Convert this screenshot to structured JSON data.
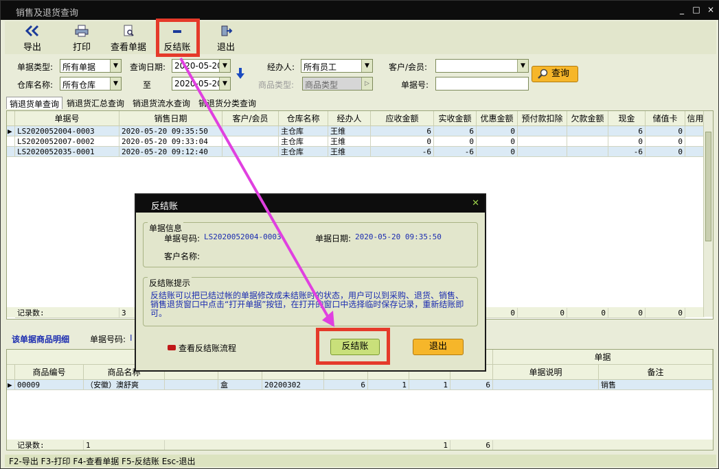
{
  "window": {
    "title": "销售及退货查询",
    "controls": [
      "_",
      "□",
      "×"
    ]
  },
  "toolbar": {
    "export": "导出",
    "print": "打印",
    "view": "查看单据",
    "reverse": "反结账",
    "exit": "退出"
  },
  "filters": {
    "doc_type_label": "单据类型:",
    "doc_type_value": "所有单据",
    "query_date_label": "查询日期:",
    "date_from": "2020-05-20",
    "staff_label": "经办人:",
    "staff_value": "所有员工",
    "customer_label": "客户/会员:",
    "customer_value": "",
    "warehouse_label": "仓库名称:",
    "warehouse_value": "所有仓库",
    "to_label": "至",
    "date_to": "2020-05-20",
    "goods_type_label": "商品类型:",
    "goods_type_value": "商品类型",
    "doc_no_label": "单据号:",
    "doc_no_value": "",
    "query_button": "查询"
  },
  "tabs": [
    "销退货单查询",
    "销退货汇总查询",
    "销退货流水查询",
    "销退货分类查询"
  ],
  "main_grid": {
    "headers": [
      "单据号",
      "销售日期",
      "客户/会员",
      "仓库名称",
      "经办人",
      "应收金额",
      "实收金额",
      "优惠金额",
      "预付款扣除",
      "欠款金额",
      "现金",
      "储值卡",
      "信用"
    ],
    "rows": [
      [
        "LS2020052004-0003",
        "2020-05-20 09:35:50",
        "",
        "主仓库",
        "王维",
        "6",
        "6",
        "0",
        "",
        "",
        "6",
        "0",
        ""
      ],
      [
        "LS2020052007-0002",
        "2020-05-20 09:33:04",
        "",
        "主仓库",
        "王维",
        "0",
        "0",
        "0",
        "",
        "",
        "0",
        "0",
        ""
      ],
      [
        "LS2020052035-0001",
        "2020-05-20 09:12:40",
        "",
        "主仓库",
        "王维",
        "-6",
        "-6",
        "0",
        "",
        "",
        "-6",
        "0",
        ""
      ]
    ],
    "footer_label": "记录数:",
    "footer_count": "3",
    "footer_tail": [
      "0",
      "0",
      "0",
      "0",
      "0"
    ]
  },
  "detail": {
    "title": "该单据商品明细",
    "doc_no_label": "单据号码:",
    "doc_no_value": "I",
    "group_header": "单据",
    "headers": [
      "商品编号",
      "商品名称",
      "",
      "",
      "",
      "",
      "",
      "",
      "",
      "单据说明",
      "备注"
    ],
    "row": [
      "00009",
      "（安徽）澳舒爽",
      "",
      "盒",
      "20200302",
      "6",
      "1",
      "1",
      "6",
      "",
      "销售"
    ],
    "footer_label": "记录数:",
    "footer_count": "1",
    "footer_nums": [
      "1",
      "6"
    ]
  },
  "statusbar": "F2-导出 F3-打印 F4-查看单据 F5-反结账 Esc-退出",
  "dialog": {
    "title": "反结账",
    "info_group": "单据信息",
    "doc_no_label": "单据号码:",
    "doc_no_value": "LS2020052004-0003",
    "doc_date_label": "单据日期:",
    "doc_date_value": "2020-05-20 09:35:50",
    "customer_label": "客户名称:",
    "tip_group": "反结账提示",
    "tip_text": "反结账可以把已结过帐的单据修改成未结账时的状态，用户可以到采购、退货、销售、销售退货窗口中点击“打开单据”按钮，在打开的窗口中选择临时保存记录，重新结账即可。",
    "flow_link": "查看反结账流程",
    "reverse_button": "反结账",
    "exit_button": "退出"
  },
  "colors": {
    "accent_red": "#e53a2a",
    "arrow": "#e040e0",
    "selected_row": "#dbeaf5",
    "button_orange": "#f6b62a",
    "button_green": "#c9e07a"
  }
}
